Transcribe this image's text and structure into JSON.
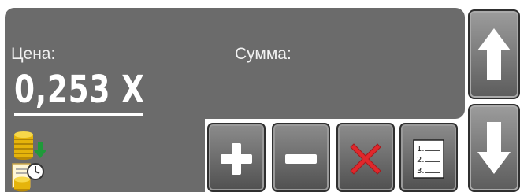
{
  "display": {
    "price_label": "Цена:",
    "price_value": "0,253 Х",
    "sum_label": "Сумма:"
  },
  "icons": {
    "coins": "coins-arrow-icon",
    "clock": "coins-clock-icon"
  },
  "buttons": {
    "add": "plus-icon",
    "remove": "minus-icon",
    "delete": "cross-icon",
    "list": "numbered-list-icon",
    "list_numbers": [
      "1.",
      "2.",
      "3."
    ]
  },
  "navigation": {
    "up": "arrow-up-icon",
    "down": "arrow-down-icon"
  },
  "colors": {
    "panel": "#6b6b6b",
    "delete_red": "#e0282c",
    "coin_gold": "#e5b40b",
    "arrow_green": "#1f9a3a"
  }
}
